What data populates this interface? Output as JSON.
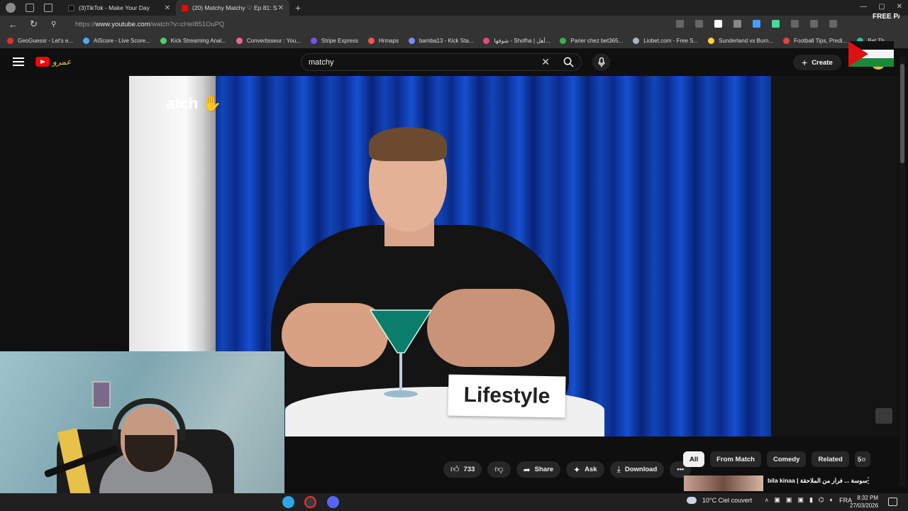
{
  "browser": {
    "tabs": [
      {
        "label": "(3)TikTok - Make Your Day",
        "active": false
      },
      {
        "label": "(20) Matchy Matchy ♡ Ep 81: S",
        "active": true
      }
    ],
    "url_prefix": "https://",
    "url_domain": "www.youtube.com",
    "url_path": "/watch?v=cHeI851OuPQ",
    "bookmarks": [
      {
        "label": "GeoGuessr - Let's e...",
        "color": "#e03131"
      },
      {
        "label": "AiScore - Live Score...",
        "color": "#4dabf7"
      },
      {
        "label": "Kick Streaming Anal...",
        "color": "#51cf66"
      },
      {
        "label": "Convertisseur : You...",
        "color": "#f06595"
      },
      {
        "label": "Stripe Express",
        "color": "#7950f2"
      },
      {
        "label": "Hrmaps",
        "color": "#fa5252"
      },
      {
        "label": "bamba13 - Kick Sta...",
        "color": "#748ffc"
      },
      {
        "label": "شوفها - Shofha | أهل...",
        "color": "#e64980"
      },
      {
        "label": "Parier chez bet365...",
        "color": "#37b24d"
      },
      {
        "label": "Liobet.com - Free S...",
        "color": "#adb5bd"
      },
      {
        "label": "Sunderland vs Burn...",
        "color": "#ffd43b"
      },
      {
        "label": "Football Tips, Predi...",
        "color": "#f03e3e"
      },
      {
        "label": "Bet Th",
        "color": "#20c997"
      }
    ]
  },
  "youtube": {
    "search_value": "matchy",
    "create_label": "Create",
    "brand_text": "عمرو"
  },
  "video": {
    "sign_text": "Lifestyle",
    "logo_text": "atch"
  },
  "actions": {
    "like_count": "733",
    "share_label": "Share",
    "ask_label": "Ask",
    "download_label": "Download"
  },
  "chips": [
    "All",
    "From Match",
    "Comedy",
    "Related",
    "Fo"
  ],
  "recommendation": {
    "title": "bila kinaa | سوسة ... فرار من الملاحقة"
  },
  "overlay": {
    "badge_text": "FREE PALESTINE"
  },
  "taskbar": {
    "weather": "10°C  Ciel couvert",
    "lang": "FRA",
    "time": "8:32 PM",
    "date": "27/03/2026"
  }
}
